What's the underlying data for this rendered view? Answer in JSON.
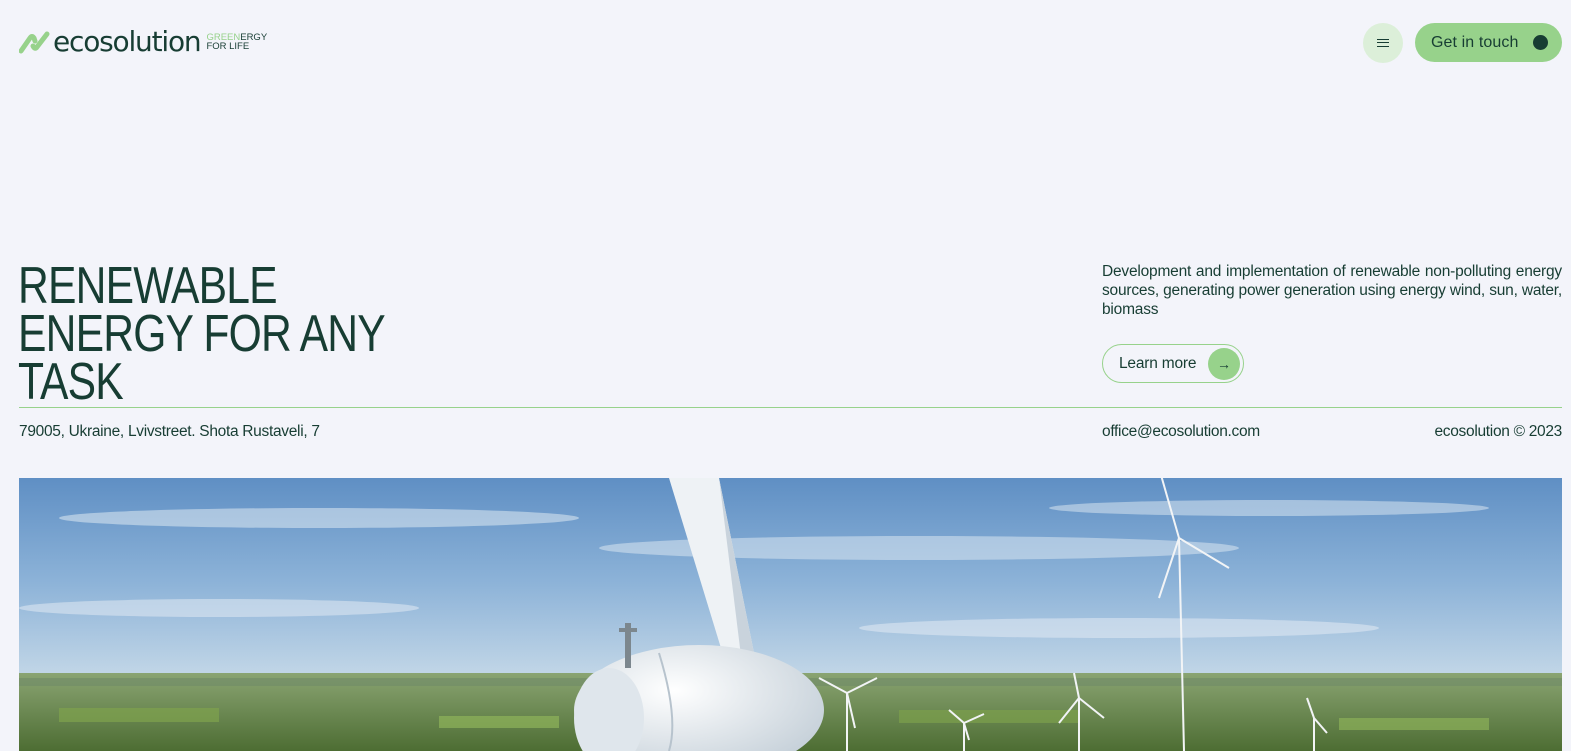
{
  "brand": {
    "name": "ecosolution",
    "tagline_green": "GREEN",
    "tagline_rest": "ERGY",
    "tagline_line2": "FOR LIFE"
  },
  "header": {
    "menu_icon": "hamburger-menu-icon",
    "cta_label": "Get in touch"
  },
  "hero": {
    "title": "RENEWABLE ENERGY FOR ANY TASK",
    "description": "Development and implementation of renewable non-polluting energy sources, generating power generation using energy wind, sun, water, biomass",
    "learn_more_label": "Learn more",
    "learn_more_icon": "arrow-right-icon"
  },
  "contacts": {
    "address": "79005, Ukraine, Lvivstreet. Shota Rustaveli, 7",
    "email": "office@ecosolution.com",
    "copyright": "ecosolution © 2023"
  },
  "colors": {
    "background": "#f3f4fa",
    "accent": "#97d28b",
    "text": "#173d33",
    "accent_light": "#dcefd9"
  }
}
